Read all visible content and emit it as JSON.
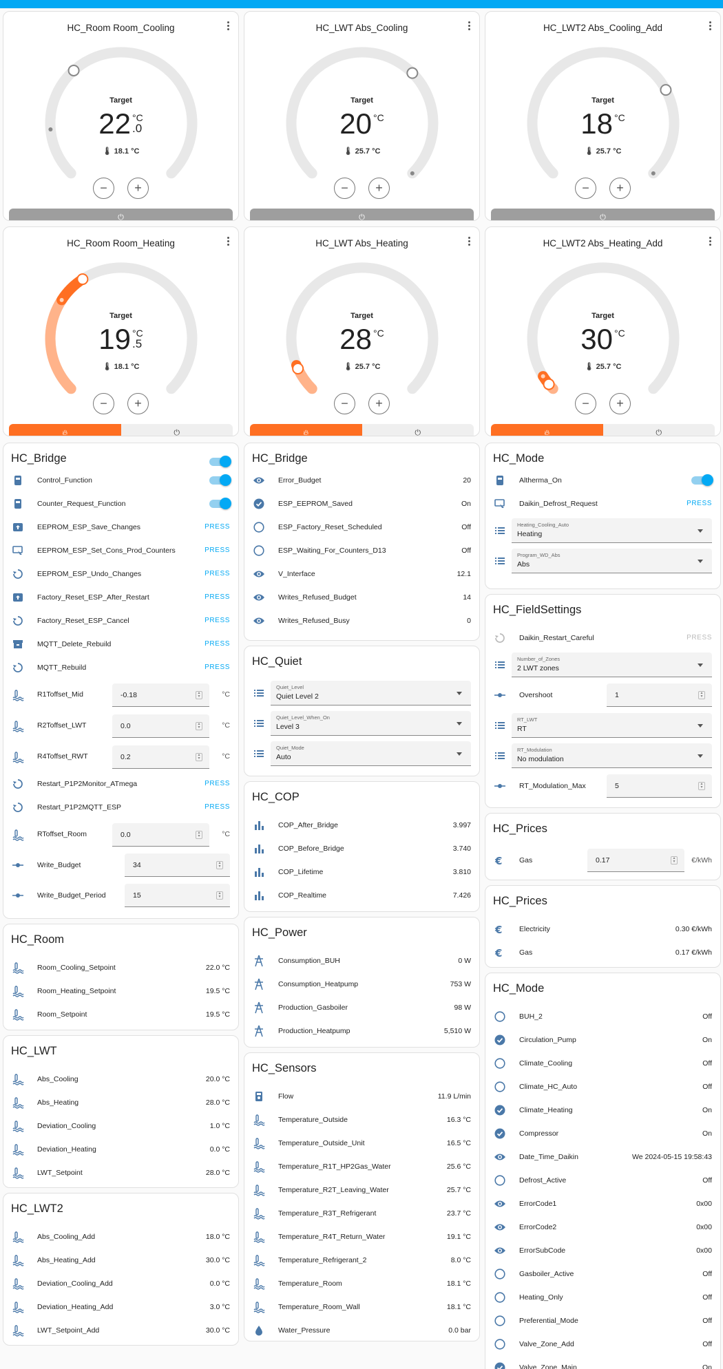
{
  "thermostats": [
    {
      "title": "HC_Room Room_Cooling",
      "label": "Target",
      "int": "22",
      "unit": "°C",
      "dec": ".0",
      "current": "18.1 °C",
      "mode": "off"
    },
    {
      "title": "HC_LWT Abs_Cooling",
      "label": "Target",
      "int": "20",
      "unit": "°C",
      "dec": "",
      "current": "25.7 °C",
      "mode": "off"
    },
    {
      "title": "HC_LWT2 Abs_Cooling_Add",
      "label": "Target",
      "int": "18",
      "unit": "°C",
      "dec": "",
      "current": "25.7 °C",
      "mode": "off"
    },
    {
      "title": "HC_Room Room_Heating",
      "label": "Target",
      "int": "19",
      "unit": "°C",
      "dec": ".5",
      "current": "18.1 °C",
      "mode": "heat"
    },
    {
      "title": "HC_LWT Abs_Heating",
      "label": "Target",
      "int": "28",
      "unit": "°C",
      "dec": "",
      "current": "25.7 °C",
      "mode": "heat"
    },
    {
      "title": "HC_LWT2 Abs_Heating_Add",
      "label": "Target",
      "int": "30",
      "unit": "°C",
      "dec": "",
      "current": "25.7 °C",
      "mode": "heat"
    }
  ],
  "bridge": {
    "title": "HC_Bridge",
    "rows": [
      {
        "label": "Control_Function"
      },
      {
        "label": "Counter_Request_Function"
      },
      {
        "label": "EEPROM_ESP_Save_Changes",
        "action": "PRESS"
      },
      {
        "label": "EEPROM_ESP_Set_Cons_Prod_Counters",
        "action": "PRESS"
      },
      {
        "label": "EEPROM_ESP_Undo_Changes",
        "action": "PRESS"
      },
      {
        "label": "Factory_Reset_ESP_After_Restart",
        "action": "PRESS"
      },
      {
        "label": "Factory_Reset_ESP_Cancel",
        "action": "PRESS"
      },
      {
        "label": "MQTT_Delete_Rebuild",
        "action": "PRESS"
      },
      {
        "label": "MQTT_Rebuild",
        "action": "PRESS"
      },
      {
        "label": "R1Toffset_Mid",
        "value": "-0.18",
        "unit": "°C"
      },
      {
        "label": "R2Toffset_LWT",
        "value": "0.0",
        "unit": "°C"
      },
      {
        "label": "R4Toffset_RWT",
        "value": "0.2",
        "unit": "°C"
      },
      {
        "label": "Restart_P1P2Monitor_ATmega",
        "action": "PRESS"
      },
      {
        "label": "Restart_P1P2MQTT_ESP",
        "action": "PRESS"
      },
      {
        "label": "RToffset_Room",
        "value": "0.0",
        "unit": "°C"
      },
      {
        "label": "Write_Budget",
        "value": "34"
      },
      {
        "label": "Write_Budget_Period",
        "value": "15"
      }
    ]
  },
  "room": {
    "title": "HC_Room",
    "rows": [
      {
        "label": "Room_Cooling_Setpoint",
        "value": "22.0 °C"
      },
      {
        "label": "Room_Heating_Setpoint",
        "value": "19.5 °C"
      },
      {
        "label": "Room_Setpoint",
        "value": "19.5 °C"
      }
    ]
  },
  "lwt": {
    "title": "HC_LWT",
    "rows": [
      {
        "label": "Abs_Cooling",
        "value": "20.0 °C"
      },
      {
        "label": "Abs_Heating",
        "value": "28.0 °C"
      },
      {
        "label": "Deviation_Cooling",
        "value": "1.0 °C"
      },
      {
        "label": "Deviation_Heating",
        "value": "0.0 °C"
      },
      {
        "label": "LWT_Setpoint",
        "value": "28.0 °C"
      }
    ]
  },
  "lwt2": {
    "title": "HC_LWT2",
    "rows": [
      {
        "label": "Abs_Cooling_Add",
        "value": "18.0 °C"
      },
      {
        "label": "Abs_Heating_Add",
        "value": "30.0 °C"
      },
      {
        "label": "Deviation_Cooling_Add",
        "value": "0.0 °C"
      },
      {
        "label": "Deviation_Heating_Add",
        "value": "3.0 °C"
      },
      {
        "label": "LWT_Setpoint_Add",
        "value": "30.0 °C"
      }
    ]
  },
  "bridge2": {
    "title": "HC_Bridge",
    "rows": [
      {
        "label": "Error_Budget",
        "value": "20"
      },
      {
        "label": "ESP_EEPROM_Saved",
        "value": "On"
      },
      {
        "label": "ESP_Factory_Reset_Scheduled",
        "value": "Off"
      },
      {
        "label": "ESP_Waiting_For_Counters_D13",
        "value": "Off"
      },
      {
        "label": "V_Interface",
        "value": "12.1"
      },
      {
        "label": "Writes_Refused_Budget",
        "value": "14"
      },
      {
        "label": "Writes_Refused_Busy",
        "value": "0"
      }
    ]
  },
  "quiet": {
    "title": "HC_Quiet",
    "rows": [
      {
        "label": "Quiet_Level",
        "value": "Quiet Level 2"
      },
      {
        "label": "Quiet_Level_When_On",
        "value": "Level 3"
      },
      {
        "label": "Quiet_Mode",
        "value": "Auto"
      }
    ]
  },
  "cop": {
    "title": "HC_COP",
    "rows": [
      {
        "label": "COP_After_Bridge",
        "value": "3.997"
      },
      {
        "label": "COP_Before_Bridge",
        "value": "3.740"
      },
      {
        "label": "COP_Lifetime",
        "value": "3.810"
      },
      {
        "label": "COP_Realtime",
        "value": "7.426"
      }
    ]
  },
  "power": {
    "title": "HC_Power",
    "rows": [
      {
        "label": "Consumption_BUH",
        "value": "0 W"
      },
      {
        "label": "Consumption_Heatpump",
        "value": "753 W"
      },
      {
        "label": "Production_Gasboiler",
        "value": "98 W"
      },
      {
        "label": "Production_Heatpump",
        "value": "5,510 W"
      }
    ]
  },
  "sensors": {
    "title": "HC_Sensors",
    "rows": [
      {
        "label": "Flow",
        "value": "11.9 L/min"
      },
      {
        "label": "Temperature_Outside",
        "value": "16.3 °C"
      },
      {
        "label": "Temperature_Outside_Unit",
        "value": "16.5 °C"
      },
      {
        "label": "Temperature_R1T_HP2Gas_Water",
        "value": "25.6 °C"
      },
      {
        "label": "Temperature_R2T_Leaving_Water",
        "value": "25.7 °C"
      },
      {
        "label": "Temperature_R3T_Refrigerant",
        "value": "23.7 °C"
      },
      {
        "label": "Temperature_R4T_Return_Water",
        "value": "19.1 °C"
      },
      {
        "label": "Temperature_Refrigerant_2",
        "value": "8.0 °C"
      },
      {
        "label": "Temperature_Room",
        "value": "18.1 °C"
      },
      {
        "label": "Temperature_Room_Wall",
        "value": "18.1 °C"
      },
      {
        "label": "Water_Pressure",
        "value": "0.0 bar"
      }
    ]
  },
  "mode": {
    "title": "HC_Mode",
    "rows": [
      {
        "label": "Altherma_On"
      },
      {
        "label": "Daikin_Defrost_Request",
        "action": "PRESS"
      },
      {
        "label": "Heating_Cooling_Auto",
        "value": "Heating"
      },
      {
        "label": "Program_WD_Abs",
        "value": "Abs"
      }
    ]
  },
  "field": {
    "title": "HC_FieldSettings",
    "rows": [
      {
        "label": "Daikin_Restart_Careful",
        "action": "PRESS"
      },
      {
        "label": "Number_of_Zones",
        "value": "2 LWT zones"
      },
      {
        "label": "Overshoot",
        "value": "1"
      },
      {
        "label": "RT_LWT",
        "value": "RT"
      },
      {
        "label": "RT_Modulation",
        "value": "No modulation"
      },
      {
        "label": "RT_Modulation_Max",
        "value": "5"
      }
    ]
  },
  "prices1": {
    "title": "HC_Prices",
    "rows": [
      {
        "label": "Gas",
        "value": "0.17",
        "unit": "€/kWh"
      }
    ]
  },
  "prices2": {
    "title": "HC_Prices",
    "rows": [
      {
        "label": "Electricity",
        "value": "0.30 €/kWh"
      },
      {
        "label": "Gas",
        "value": "0.17 €/kWh"
      }
    ]
  },
  "mode2": {
    "title": "HC_Mode",
    "rows": [
      {
        "label": "BUH_2",
        "value": "Off"
      },
      {
        "label": "Circulation_Pump",
        "value": "On"
      },
      {
        "label": "Climate_Cooling",
        "value": "Off"
      },
      {
        "label": "Climate_HC_Auto",
        "value": "Off"
      },
      {
        "label": "Climate_Heating",
        "value": "On"
      },
      {
        "label": "Compressor",
        "value": "On"
      },
      {
        "label": "Date_Time_Daikin",
        "value": "We 2024-05-15 19:58:43"
      },
      {
        "label": "Defrost_Active",
        "value": "Off"
      },
      {
        "label": "ErrorCode1",
        "value": "0x00"
      },
      {
        "label": "ErrorCode2",
        "value": "0x00"
      },
      {
        "label": "ErrorSubCode",
        "value": "0x00"
      },
      {
        "label": "Gasboiler_Active",
        "value": "Off"
      },
      {
        "label": "Heating_Only",
        "value": "Off"
      },
      {
        "label": "Preferential_Mode",
        "value": "Off"
      },
      {
        "label": "Valve_Zone_Add",
        "value": "Off"
      },
      {
        "label": "Valve_Zone_Main",
        "value": "On"
      }
    ]
  },
  "colors": {
    "heat": "#ff6f22",
    "heat_light": "#ffb38a",
    "off_button": "#9e9e9e",
    "accent": "#03a9f4",
    "icon": "#4a78a8"
  }
}
